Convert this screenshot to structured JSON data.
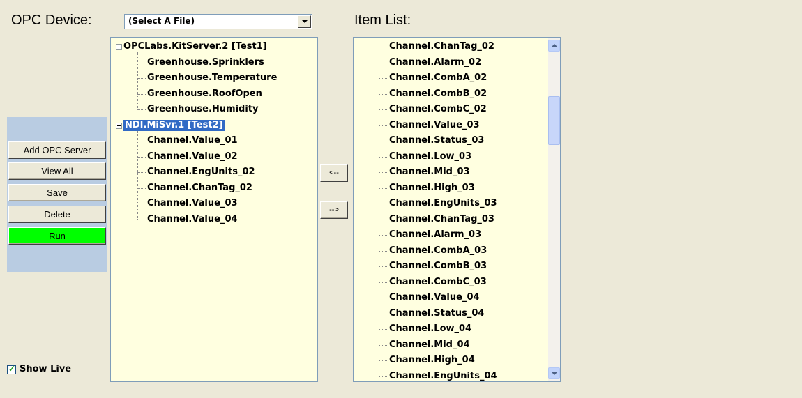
{
  "header": {
    "opc_device_label": "OPC Device:",
    "item_list_label": "Item List:"
  },
  "device_select": {
    "value": "(Select A File)"
  },
  "buttons": {
    "add_opc_server": "Add OPC Server",
    "view_all": "View All",
    "save": "Save",
    "delete": "Delete",
    "run": "Run",
    "move_left": "<--",
    "move_right": "-->"
  },
  "show_live": {
    "label": "Show Live",
    "checked": true
  },
  "server_tree": {
    "servers": [
      {
        "label": "OPCLabs.KitServer.2 [Test1]",
        "items": [
          "Greenhouse.Sprinklers",
          "Greenhouse.Temperature",
          "Greenhouse.RoofOpen",
          "Greenhouse.Humidity"
        ]
      },
      {
        "label": "NDI.MiSvr.1 [Test2]",
        "selected": true,
        "items": [
          "Channel.Value_01",
          "Channel.Value_02",
          "Channel.EngUnits_02",
          "Channel.ChanTag_02",
          "Channel.Value_03",
          "Channel.Value_04"
        ]
      }
    ]
  },
  "item_list": {
    "items": [
      "Channel.ChanTag_02",
      "Channel.Alarm_02",
      "Channel.CombA_02",
      "Channel.CombB_02",
      "Channel.CombC_02",
      "Channel.Value_03",
      "Channel.Status_03",
      "Channel.Low_03",
      "Channel.Mid_03",
      "Channel.High_03",
      "Channel.EngUnits_03",
      "Channel.ChanTag_03",
      "Channel.Alarm_03",
      "Channel.CombA_03",
      "Channel.CombB_03",
      "Channel.CombC_03",
      "Channel.Value_04",
      "Channel.Status_04",
      "Channel.Low_04",
      "Channel.Mid_04",
      "Channel.High_04",
      "Channel.EngUnits_04"
    ]
  },
  "colors": {
    "panel_bg": "#FFFFE0",
    "run_button": "#00FF00",
    "left_panel": "#B9CCE2",
    "selection": "#316AC5"
  }
}
